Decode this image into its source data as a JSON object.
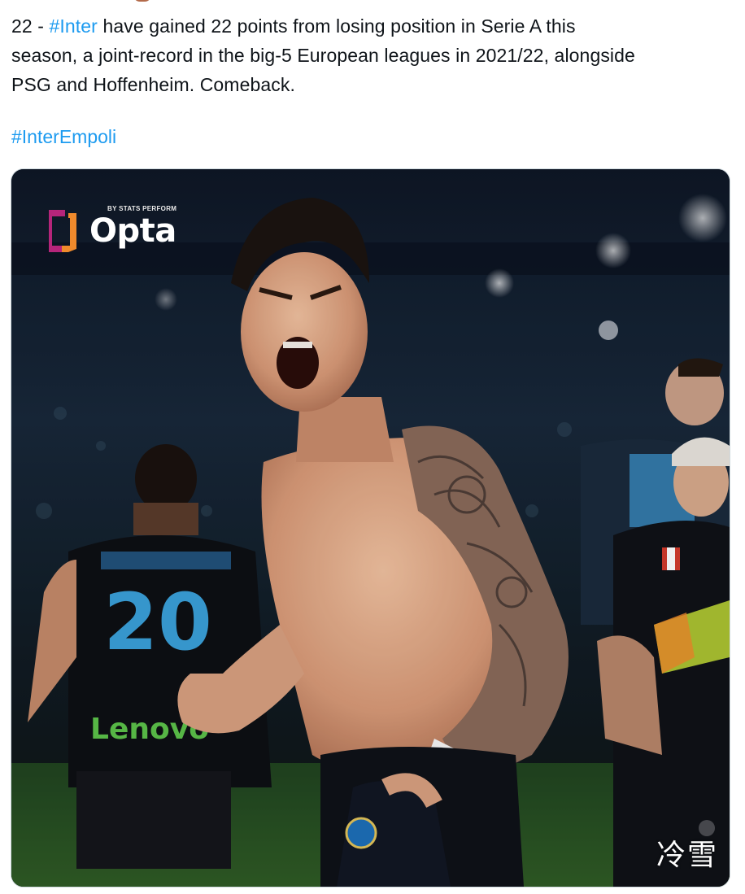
{
  "tweet": {
    "text_line1_prefix": "22 - ",
    "hashtag_inter": "#Inter",
    "text_line1_suffix": " have gained 22 points from losing position in Serie A this",
    "text_line2": "season, a joint-record in the big-5 European leagues in 2021/22, alongside",
    "text_line3": "PSG and Hoffenheim. Comeback.",
    "hashtag_footer": "#InterEmpoli"
  },
  "media": {
    "logo_word": "Opta",
    "logo_sub": "BY STATS PERFORM",
    "shirt_number": "20",
    "shirt_sponsor": "Lenovo",
    "watermark": "冷雪"
  },
  "colors": {
    "hashtag": "#1d9bf0",
    "text": "#0f1419",
    "opta_magenta": "#b5257a",
    "opta_orange": "#f08a2c"
  }
}
